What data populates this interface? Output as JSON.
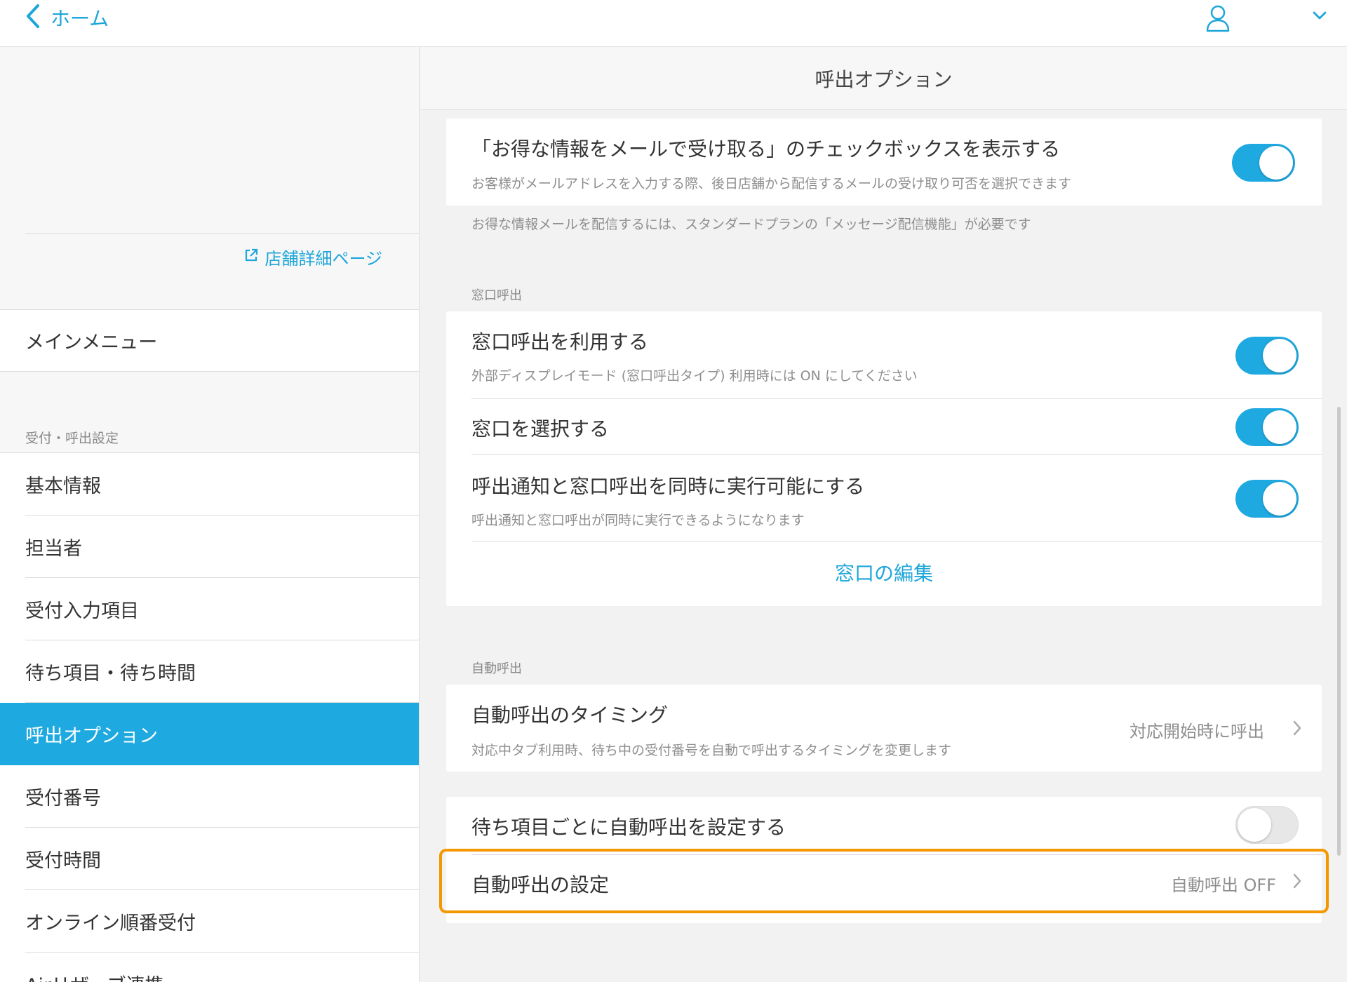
{
  "header": {
    "back_label": "ホーム"
  },
  "sidebar": {
    "store_link": "店舗詳細ページ",
    "main_menu": "メインメニュー",
    "section_label": "受付・呼出設定",
    "items": [
      {
        "label": "基本情報"
      },
      {
        "label": "担当者"
      },
      {
        "label": "受付入力項目"
      },
      {
        "label": "待ち項目・待ち時間"
      },
      {
        "label": "呼出オプション"
      },
      {
        "label": "受付番号"
      },
      {
        "label": "受付時間"
      },
      {
        "label": "オンライン順番受付"
      },
      {
        "label": "Airリザーブ連携"
      }
    ],
    "active_index": 4
  },
  "main": {
    "title": "呼出オプション",
    "email_card": {
      "title": "「お得な情報をメールで受け取る」のチェックボックスを表示する",
      "subtitle": "お客様がメールアドレスを入力する際、後日店舗から配信するメールの受け取り可否を選択できます",
      "toggle_on": true
    },
    "email_note": "お得な情報メールを配信するには、スタンダードプランの「メッセージ配信機能」が必要です",
    "window_section": {
      "label": "窓口呼出",
      "rows": [
        {
          "title": "窓口呼出を利用する",
          "subtitle": "外部ディスプレイモード (窓口呼出タイプ) 利用時には ON にしてください",
          "toggle_on": true
        },
        {
          "title": "窓口を選択する",
          "toggle_on": true
        },
        {
          "title": "呼出通知と窓口呼出を同時に実行可能にする",
          "subtitle": "呼出通知と窓口呼出が同時に実行できるようになります",
          "toggle_on": true
        }
      ],
      "edit_link": "窓口の編集"
    },
    "auto_section": {
      "label": "自動呼出",
      "timing": {
        "title": "自動呼出のタイミング",
        "subtitle": "対応中タブ利用時、待ち中の受付番号を自動で呼出するタイミングを変更します",
        "value": "対応開始時に呼出"
      },
      "per_item": {
        "title": "待ち項目ごとに自動呼出を設定する",
        "toggle_on": false
      },
      "setting": {
        "title": "自動呼出の設定",
        "value": "自動呼出 OFF"
      }
    }
  },
  "colors": {
    "accent": "#1fa9e1",
    "highlight": "#f39800"
  }
}
